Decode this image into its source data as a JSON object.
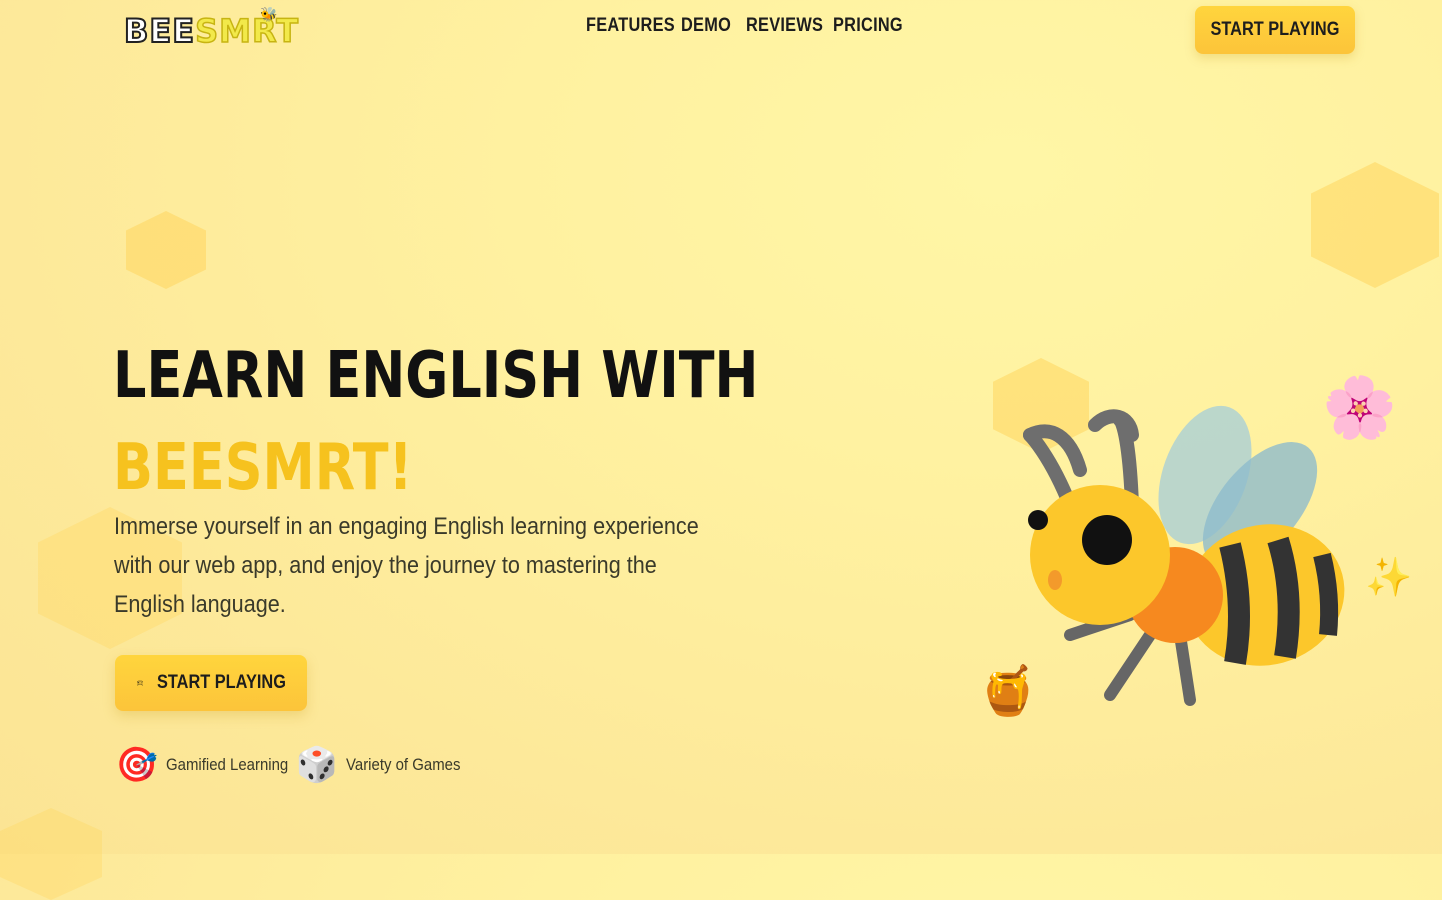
{
  "header": {
    "logo_text_bee": "BEE",
    "logo_text_smrt": "SMRT",
    "nav": [
      "FEATURES",
      "DEMO",
      "REVIEWS",
      "PRICING"
    ],
    "cta_label": "START PLAYING"
  },
  "hero": {
    "title_line1": "LEARN ENGLISH WITH",
    "title_line2": "BEESMRT!",
    "description": "Immerse yourself in an engaging English learning experience with our web app, and enjoy the journey to mastering the English language.",
    "cta_label": "START PLAYING",
    "cta_icon": "gamepad-icon",
    "features": [
      {
        "icon": "target-icon",
        "glyph": "🎯",
        "label": "Gamified Learning"
      },
      {
        "icon": "dice-icon",
        "glyph": "🎲",
        "label": "Variety of Games"
      }
    ]
  },
  "decorations": {
    "bee": "bee-icon",
    "flower_glyph": "🌸",
    "sparkle_glyph": "✨",
    "honey_glyph": "🍯"
  },
  "colors": {
    "accent": "#f6c21e",
    "button": "#fcc43a",
    "background": "#fff1a0",
    "text": "#111111"
  }
}
